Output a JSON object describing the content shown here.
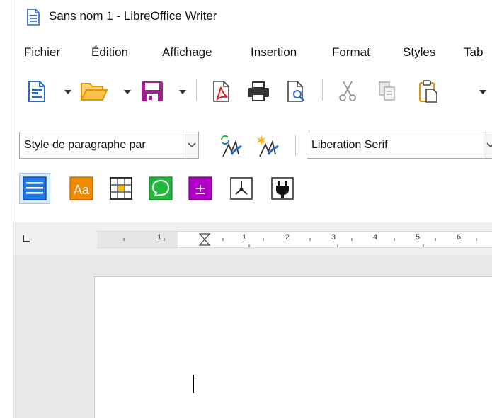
{
  "window": {
    "title": "Sans nom 1 - LibreOffice Writer"
  },
  "menubar": {
    "items": [
      {
        "accel": "F",
        "rest": "ichier"
      },
      {
        "accel": "É",
        "rest": "dition"
      },
      {
        "accel": "A",
        "rest": "ffichage"
      },
      {
        "accel": "I",
        "rest": "nsertion"
      },
      {
        "pre": "Forma",
        "accel": "t",
        "rest": ""
      },
      {
        "pre": "St",
        "accel": "y",
        "rest": "les"
      },
      {
        "pre": "Ta",
        "accel": "b",
        "rest": ""
      }
    ]
  },
  "toolbar1": {
    "icons": [
      "new-document-icon",
      "open-folder-icon",
      "save-icon",
      "export-pdf-icon",
      "print-icon",
      "print-preview-icon",
      "cut-icon",
      "copy-icon",
      "paste-icon"
    ]
  },
  "toolbar2": {
    "paragraph_style": "Style de paragraphe par",
    "font_name": "Liberation Serif"
  },
  "toolbar3": {
    "icons": [
      "align-icon",
      "character-style-icon",
      "table-icon",
      "comment-icon",
      "formula-icon",
      "draw-shape-icon",
      "extension-plug-icon"
    ]
  },
  "ruler": {
    "numbers": [
      "1",
      "1",
      "2",
      "3",
      "4",
      "5",
      "6"
    ]
  },
  "colors": {
    "accent_blue": "#1e78e6",
    "orange": "#f08a00",
    "green": "#22b83a",
    "purple": "#b000c8",
    "save_purple": "#a2208f"
  }
}
